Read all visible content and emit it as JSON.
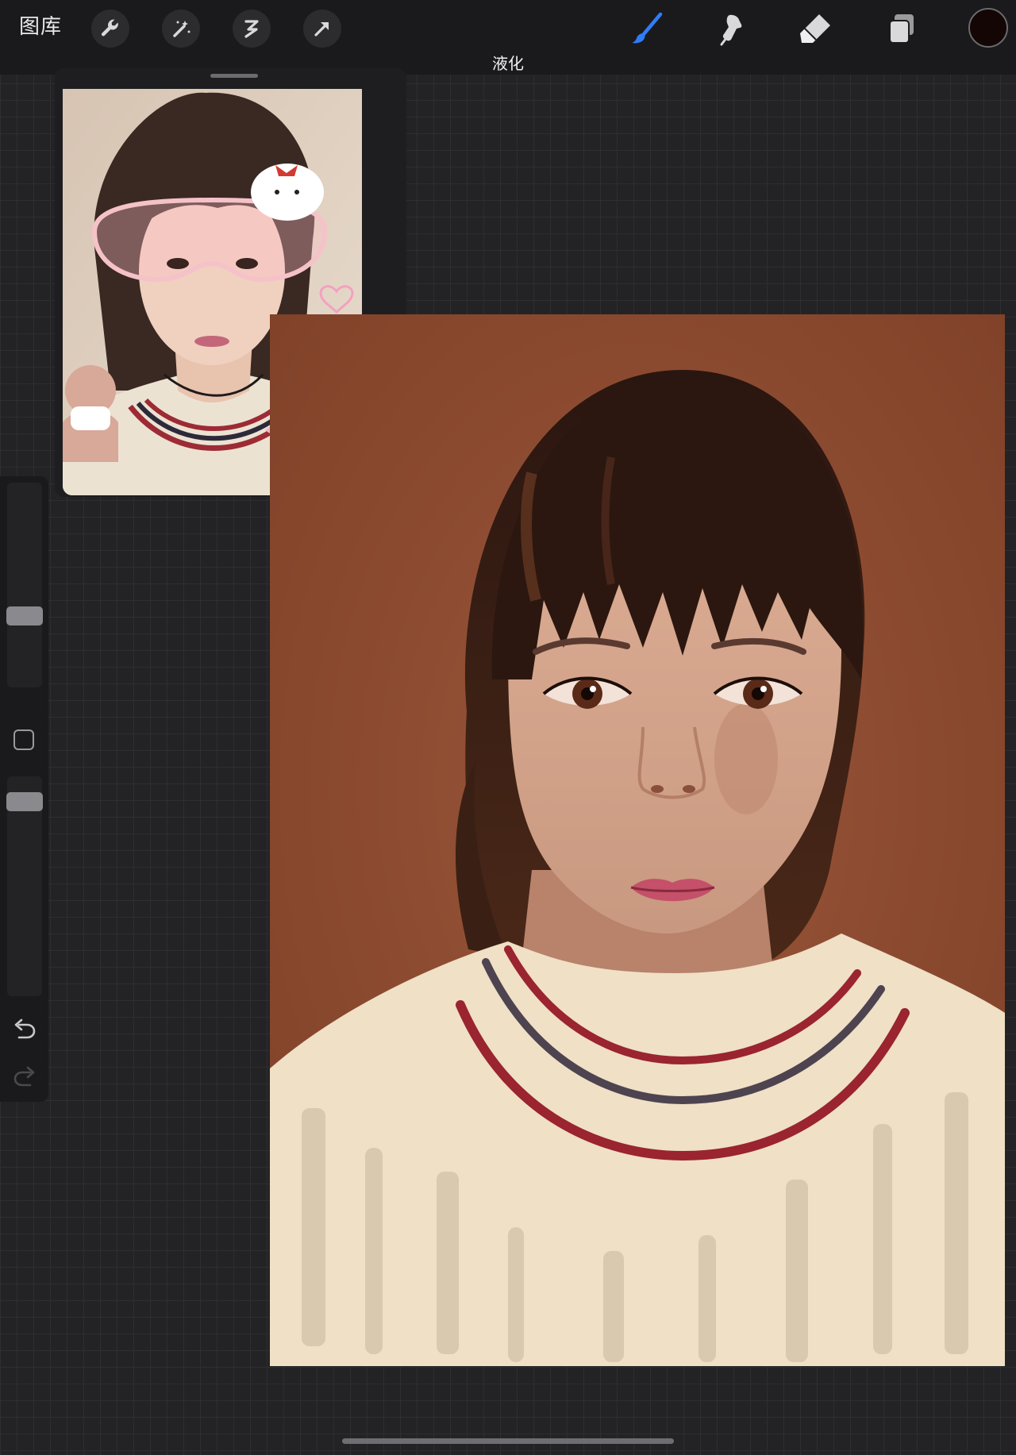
{
  "toolbar": {
    "gallery_label": "图库",
    "left_tools": [
      "wrench-icon",
      "magic-wand-icon",
      "selection-icon",
      "transform-arrow-icon"
    ],
    "right_tools": [
      "brush-icon",
      "smudge-icon",
      "eraser-icon",
      "layers-icon"
    ],
    "active_tool": "brush",
    "active_color": "#140604",
    "accent_color": "#2f7cf6"
  },
  "mode": {
    "label": "液化"
  },
  "reference": {
    "icon": "reference-photo-icon"
  },
  "sidebar": {
    "brush_size_icon": "brush-size-slider",
    "opacity_icon": "opacity-slider",
    "modify_icon": "square-modify-icon",
    "undo_icon": "undo-arrow-icon",
    "redo_icon": "redo-arrow-icon"
  },
  "canvas": {
    "background_color": "#8c4a30",
    "sweater_color": "#efe0c6",
    "stripe_red": "#9a2430",
    "stripe_gray": "#4e4450"
  }
}
